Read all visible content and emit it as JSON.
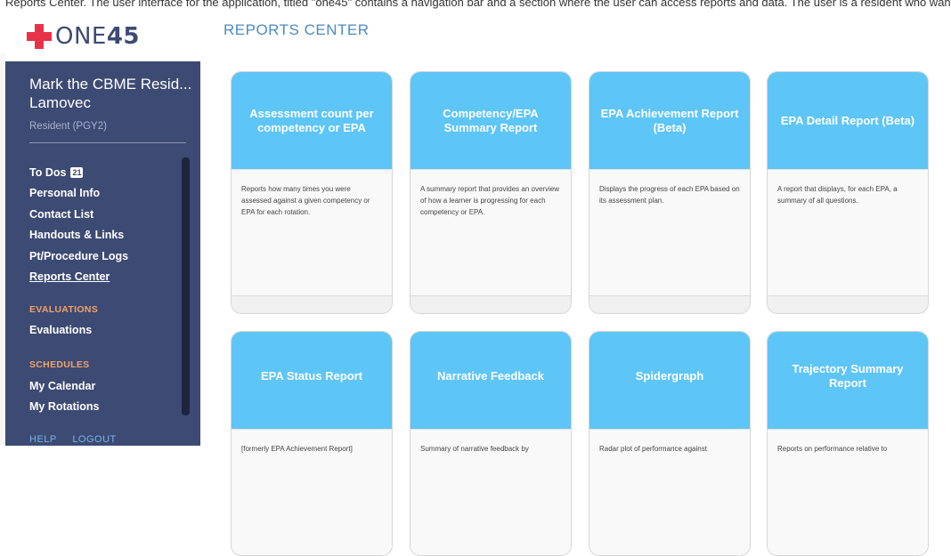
{
  "top_strip_text": "Reports Center. The user interface for the application, titled \"one45\" contains a navigation bar and a section where the user can access reports and data. The user is a resident who wants to see their progress for each competency the EPA.",
  "logo": {
    "word": "ONE",
    "number": "45",
    "brand_color": "#e8324a"
  },
  "user": {
    "name": "Mark the CBME Resid...",
    "surname": "Lamovec",
    "role": "Resident (PGY2)"
  },
  "nav": {
    "items": [
      {
        "label": "To Dos",
        "badge": "21"
      },
      {
        "label": "Personal Info"
      },
      {
        "label": "Contact List"
      },
      {
        "label": "Handouts & Links"
      },
      {
        "label": "Pt/Procedure Logs"
      },
      {
        "label": "Reports Center",
        "active": true
      }
    ],
    "evaluations_header": "EVALUATIONS",
    "evaluations_item": "Evaluations",
    "schedules_header": "SCHEDULES",
    "schedules_items": [
      "My Calendar",
      "My Rotations"
    ]
  },
  "footer": {
    "help": "HELP",
    "logout": "LOGOUT"
  },
  "main": {
    "title": "REPORTS CENTER",
    "cards": [
      {
        "title": "Assessment count per competency or EPA",
        "description": "Reports how many times you were assessed against a given competency or EPA for each rotation."
      },
      {
        "title": "Competency/EPA Summary Report",
        "description": "A summary report that provides an overview of how a learner is progressing for each competency or EPA."
      },
      {
        "title": "EPA Achievement Report (Beta)",
        "description": "Displays the progress of each EPA based on its assessment plan."
      },
      {
        "title": "EPA Detail Report (Beta)",
        "description": "A report that displays, for each EPA, a summary of all questions."
      },
      {
        "title": "EPA Status Report",
        "description": "[formerly EPA Achievement Report]"
      },
      {
        "title": "Narrative Feedback",
        "description": "Summary of narrative feedback by"
      },
      {
        "title": "Spidergraph",
        "description": "Radar plot of performance against"
      },
      {
        "title": "Trajectory Summary Report",
        "description": "Reports on performance relative to"
      }
    ]
  },
  "colors": {
    "sidebar_bg": "#3d4a73",
    "card_header": "#5ec5f7",
    "title_blue": "#4a8cc4",
    "section_orange": "#f0a36b"
  }
}
